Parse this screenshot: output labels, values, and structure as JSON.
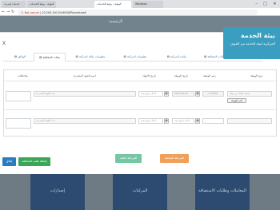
{
  "browser": {
    "tabs": [
      {
        "label": "خدمات إنترنت"
      },
      {
        "label": "البوابة - بوابة الخدمات"
      },
      {
        "label": "البوابة - بوابة الخدمات"
      },
      {
        "label": "Windows"
      }
    ],
    "window_controls": {
      "minimize": "–",
      "maximize": "□",
      "close": "✕"
    },
    "nav": {
      "back": "←",
      "forward": "→",
      "reload": "↻"
    },
    "address": {
      "security_label": "Not secure",
      "url": "10.200.100.54:8000/Procedure#"
    }
  },
  "background": {
    "header_label": "الرئيسية",
    "cards": [
      "إصدارات",
      "المركبات",
      "المعاملات وطلبات الاستضافة"
    ]
  },
  "brand": {
    "title": "بيئة الخدمة",
    "subtitle": "المركزية لبيئة الخدمة من الفنون"
  },
  "modal": {
    "close_label": "X",
    "tabs": [
      {
        "label": "الوثائق",
        "icon": "▤"
      },
      {
        "label": "بيانات المخالفة",
        "icon": "▤"
      },
      {
        "label": "معلومات مالك المركبة",
        "icon": "▤"
      },
      {
        "label": "معلومات المركبة",
        "icon": "▤"
      },
      {
        "label": "بيانات المركبة",
        "icon": "▤"
      },
      {
        "label": "بيانات المخالفة",
        "icon": "▤"
      }
    ],
    "columns": [
      "نوع الوثيقة",
      "رقم الوثيقة",
      "تاريخ الوثيقة",
      "تاريخ الانتهاء",
      "اسم الجهة المصدرة",
      "ملاحظات"
    ],
    "rows": [
      {
        "doc_type": "رخصة قيادة من دولة",
        "browse_label": "اختر الوثيقة",
        "doc_number": "123456",
        "doc_date": "2017/12/27",
        "expiry_date": "أدخل تاريخ سنة",
        "issuer": "حدد الجهة المصدرة",
        "notes": ""
      },
      {
        "doc_type": "",
        "browse_label": "",
        "doc_number": "",
        "doc_date": "أدخل تاريخ سنة",
        "expiry_date": "أدخل تاريخ سنة",
        "issuer": "حدد الجهة المصدرة",
        "notes": ""
      }
    ],
    "calendar_icon": "▦",
    "buttons": {
      "prev": "المرحلة السابقة",
      "next": "المرحلة التالية",
      "add": "إضافة طلب المخالفة",
      "close": "إغلاق"
    }
  }
}
